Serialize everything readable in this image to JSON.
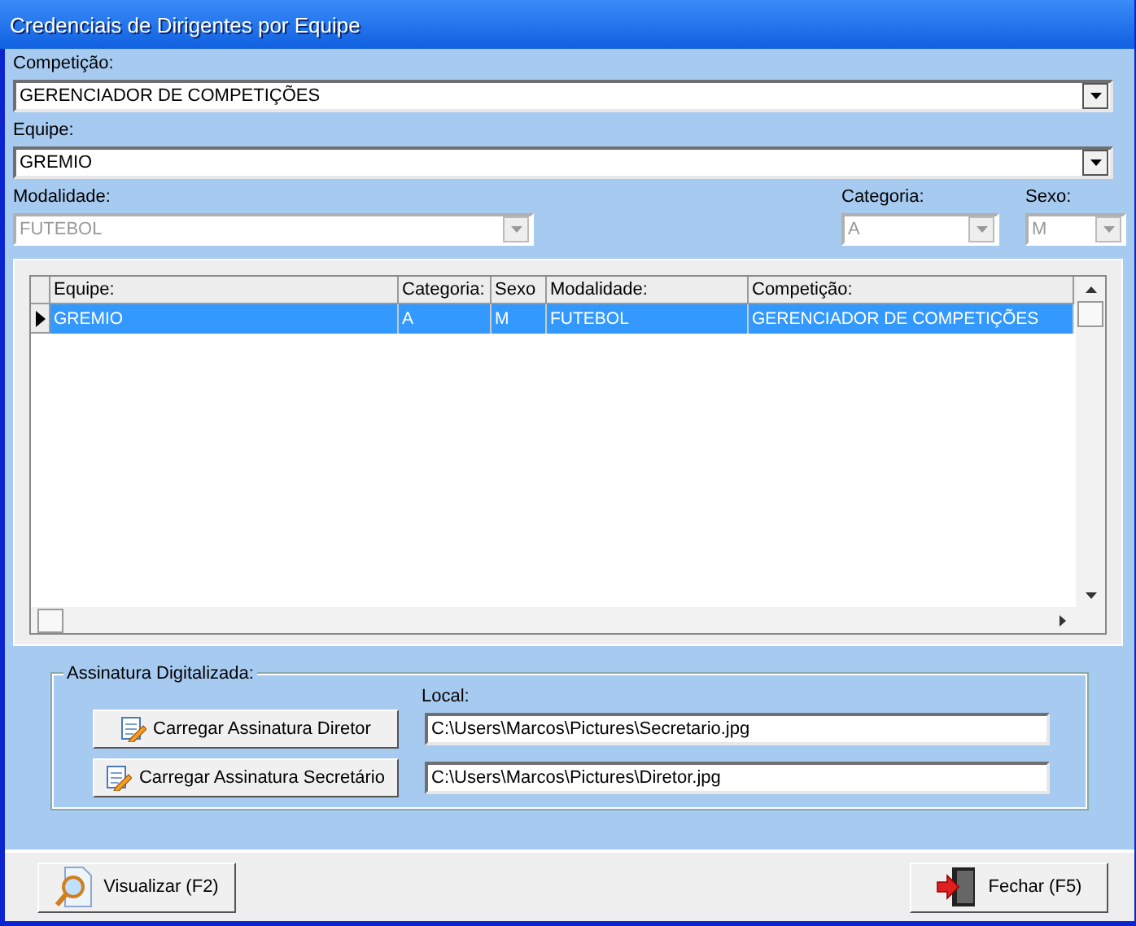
{
  "window": {
    "title": "Credenciais de Dirigentes por Equipe"
  },
  "competicao": {
    "label": "Competição:",
    "value": "GERENCIADOR DE COMPETIÇÕES",
    "disabled": false
  },
  "equipe": {
    "label": "Equipe:",
    "value": "GREMIO",
    "disabled": false
  },
  "modalidade": {
    "label": "Modalidade:",
    "value": "FUTEBOL",
    "disabled": true
  },
  "categoria": {
    "label": "Categoria:",
    "value": "A",
    "disabled": true
  },
  "sexo": {
    "label": "Sexo:",
    "value": "M",
    "disabled": true
  },
  "table": {
    "columns": [
      "Equipe:",
      "Categoria:",
      "Sexo",
      "Modalidade:",
      "Competição:"
    ],
    "rows": [
      {
        "cells": [
          "GREMIO",
          "A",
          "M",
          "FUTEBOL",
          "GERENCIADOR DE COMPETIÇÕES"
        ],
        "selected": true
      }
    ]
  },
  "signature": {
    "title": "Assinatura Digitalizada:",
    "local_label": "Local:",
    "items": [
      {
        "button": "Carregar Assinatura Diretor",
        "path": "C:\\Users\\Marcos\\Pictures\\Secretario.jpg"
      },
      {
        "button": "Carregar Assinatura Secretário",
        "path": "C:\\Users\\Marcos\\Pictures\\Diretor.jpg"
      }
    ]
  },
  "buttons": [
    {
      "kind": "preview",
      "label": "Visualizar (F2)"
    },
    {
      "kind": "close",
      "label": "Fechar (F5)"
    }
  ]
}
